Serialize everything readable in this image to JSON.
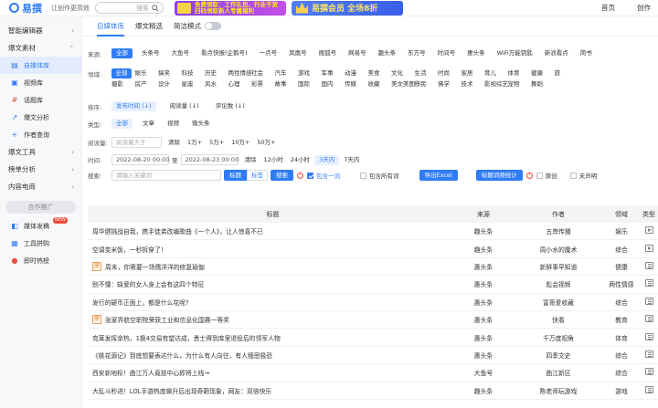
{
  "header": {
    "logo_text": "易撰",
    "slogan": "让创作更高效",
    "search_placeholder": "搜索",
    "banner1_line1": "免费领取：工作礼包、行业干货",
    "banner1_line2": "扫码领取新人专属福利",
    "banner2_text": "易撰会员 全场8折",
    "links": [
      "首页",
      "创作"
    ]
  },
  "sidebar": {
    "groups": [
      {
        "label": "智能编辑器",
        "chev": "›"
      },
      {
        "label": "爆文素材",
        "chev": "⌃"
      }
    ],
    "items1": [
      {
        "label": "自媒体库",
        "active": true
      },
      {
        "label": "视频库"
      },
      {
        "label": "话题库"
      },
      {
        "label": "爆文分析"
      },
      {
        "label": "作者查询"
      }
    ],
    "groups2": [
      {
        "label": "爆文工具",
        "chev": "›"
      },
      {
        "label": "榜单分析",
        "chev": "›"
      },
      {
        "label": "内容电商",
        "chev": "›"
      }
    ],
    "promo_button": "合作推广",
    "items2": [
      {
        "label": "媒体发稿",
        "badge": "NEW"
      },
      {
        "label": "工具拼购"
      },
      {
        "label": "即时热榜"
      }
    ]
  },
  "tabs": [
    {
      "label": "自媒体库",
      "active": true
    },
    {
      "label": "爆文精选"
    },
    {
      "label": "简洁模式"
    }
  ],
  "filters": {
    "source_label": "来源:",
    "sources": [
      "全部",
      "头条号",
      "大鱼号",
      "看点快报(企鹅号)",
      "一点号",
      "凤凰号",
      "搜狐号",
      "网易号",
      "趣头条",
      "东方号",
      "时间号",
      "惠头条",
      "WiFi万能钥匙",
      "新浪看点",
      "简书"
    ],
    "field_label": "领域:",
    "fields": [
      "全部",
      "娱乐",
      "搞笑",
      "科技",
      "历史",
      "两性情感",
      "社会",
      "汽车",
      "游戏",
      "军事",
      "动漫",
      "美食",
      "文化",
      "生活",
      "时尚",
      "家居",
      "育儿",
      "体育",
      "健康",
      "旅",
      "摄影",
      "房产",
      "设计",
      "星座",
      "风水",
      "心理",
      "彩票",
      "故事",
      "国际",
      "国内",
      "传媒",
      "收藏",
      "美文美图",
      "移民",
      "佛学",
      "技术",
      "影视综艺",
      "宠物",
      "舞蹈"
    ],
    "sort_label": "排序:",
    "sorts": [
      "发布时间 (↓)",
      "阅读量 (↓)",
      "评论数 (↓)"
    ],
    "type_label": "类型:",
    "types": [
      "全部",
      "文章",
      "视频",
      "微头条"
    ],
    "reads_label": "阅读量:",
    "reads_placeholder": "阅读量大于",
    "reads_options": [
      "清除",
      "1万+",
      "5万+",
      "10万+",
      "50万+"
    ],
    "time_label": "时间:",
    "date_from": "2022-08-20 00:00",
    "date_to": "2022-08-23 00:00",
    "date_sep": "至",
    "time_options": [
      "清除",
      "12小时",
      "24小时",
      "3天内",
      "7天内"
    ],
    "search_label": "搜索:",
    "keyword_placeholder": "请输入关键词",
    "scope_title": "标题",
    "scope_tag": "标签",
    "search_button": "搜索",
    "contains_one": "包含一词",
    "contains_all": "包含所有词",
    "export_button": "导出Excel",
    "stats_button": "标题词频统计",
    "original": "原创",
    "not_declared": "未声明"
  },
  "table": {
    "headers": [
      "标题",
      "来源",
      "作者",
      "领域",
      "类型"
    ],
    "rows": [
      {
        "title": "周华健挑战自我，携手徒弟改编歌曲《一个人》，让人惊喜不已",
        "source": "趣头条",
        "author": "五岸传播",
        "field": "娱乐",
        "type": "video",
        "img": false
      },
      {
        "title": "空调变米饭，一秒拆穿了！",
        "source": "趣头条",
        "author": "周小水的魔术",
        "field": "综合",
        "type": "video",
        "img": false
      },
      {
        "title": "周末，你需要一场儒洋洋的修复瑜伽",
        "source": "惠头条",
        "author": "新鲜事早知道",
        "field": "健康",
        "type": "doc",
        "img": true
      },
      {
        "title": "别不懂：缺爱的女人身上会有这四个特征",
        "source": "惠头条",
        "author": "彪会视频",
        "field": "两性情感",
        "type": "doc",
        "img": false
      },
      {
        "title": "发行的硬币正面上，都是什么花呢?",
        "source": "惠头条",
        "author": "富哥爱收藏",
        "field": "综合",
        "type": "doc",
        "img": false
      },
      {
        "title": "张家界航空职院荣获工业和信息化国赛一等奖",
        "source": "惠头条",
        "author": "快看",
        "field": "教育",
        "type": "doc",
        "img": true
      },
      {
        "title": "克莱发挥余热，1换4交易有望达成，勇士得到库里退役后的领军人物",
        "source": "惠头条",
        "author": "千万度视角",
        "field": "体育",
        "type": "doc",
        "img": false
      },
      {
        "title": "《桃花源记》到底想要表达什么，为什么有人向往，有人细思极恐",
        "source": "惠头条",
        "author": "四季文史",
        "field": "综合",
        "type": "doc",
        "img": false
      },
      {
        "title": "西安新地标！曲江万人竟技中心即将上线→",
        "source": "大鱼号",
        "author": "曲江新区",
        "field": "综合",
        "type": "doc",
        "img": false
      },
      {
        "title": "大乱斗秒进！LOL手游热度飙升后出现奇葩现象，网友：双倍快乐",
        "source": "趣头条",
        "author": "陈老师玩游戏",
        "field": "游戏",
        "type": "doc",
        "img": false
      }
    ]
  }
}
